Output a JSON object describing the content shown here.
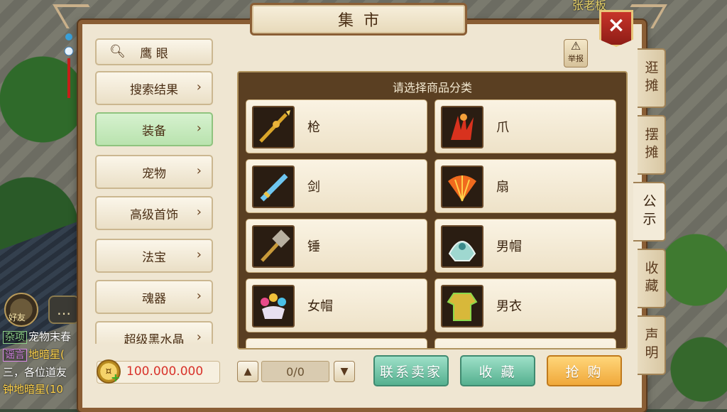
{
  "background": {
    "npc_name": "张老板"
  },
  "chat": {
    "avatar_label": "好友",
    "bubble_icon": "speech-bubble-icon",
    "lines": [
      {
        "tag": "杂项",
        "text": "宠物末春"
      },
      {
        "tag": "谣言",
        "text": "地暗星("
      },
      {
        "tag": "",
        "text": "三，各位道友"
      },
      {
        "tag": "",
        "text": "钟地暗星(10"
      }
    ]
  },
  "window": {
    "title": "集市",
    "close_icon": "close-x-icon",
    "report_label": "举报"
  },
  "nav": {
    "search_label": "鹰  眼",
    "items": [
      {
        "label": "搜索结果",
        "active": false
      },
      {
        "label": "装备",
        "active": true
      },
      {
        "label": "宠物",
        "active": false
      },
      {
        "label": "高级首饰",
        "active": false
      },
      {
        "label": "法宝",
        "active": false
      },
      {
        "label": "魂器",
        "active": false
      },
      {
        "label": "超级黑水晶",
        "active": false
      }
    ]
  },
  "panel": {
    "title": "请选择商品分类",
    "items": [
      {
        "label": "枪",
        "icon": "spear-icon"
      },
      {
        "label": "爪",
        "icon": "claw-icon"
      },
      {
        "label": "剑",
        "icon": "sword-icon"
      },
      {
        "label": "扇",
        "icon": "fan-icon"
      },
      {
        "label": "锤",
        "icon": "hammer-icon"
      },
      {
        "label": "男帽",
        "icon": "male-hat-icon"
      },
      {
        "label": "女帽",
        "icon": "female-hat-icon"
      },
      {
        "label": "男衣",
        "icon": "male-armor-icon"
      }
    ]
  },
  "tabs": [
    {
      "label": "逛摊",
      "active": false
    },
    {
      "label": "摆摊",
      "active": false
    },
    {
      "label": "公示",
      "active": true
    },
    {
      "label": "收藏",
      "active": false
    },
    {
      "label": "声明",
      "active": false
    }
  ],
  "bottom": {
    "money": "100.000.000",
    "page": "0/0",
    "buttons": {
      "contact": "联系卖家",
      "favorite": "收  藏",
      "buy": "抢  购"
    }
  },
  "colors": {
    "accent_green": "#55b08f",
    "accent_orange": "#f0a83a",
    "frame_brown": "#8a5e35",
    "money_red": "#d8322a"
  }
}
